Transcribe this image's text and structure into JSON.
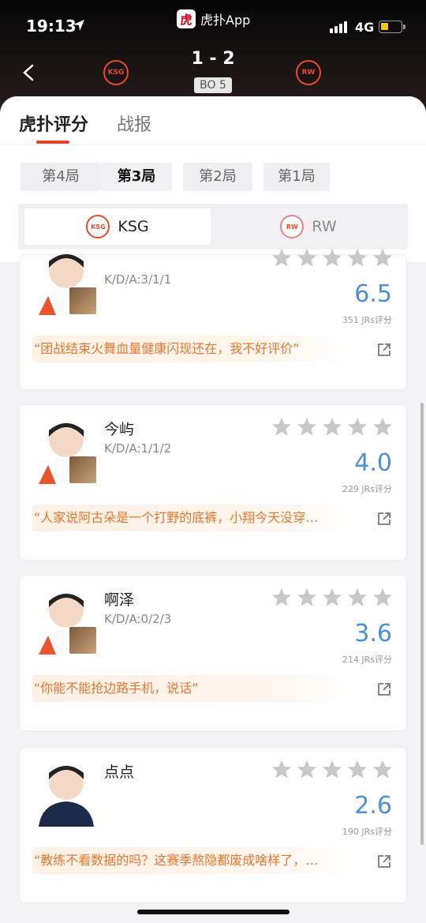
{
  "status_bar": {
    "time": "19:13",
    "network": "4G"
  },
  "app": {
    "name": "虎扑App",
    "logo_char": "虎"
  },
  "match": {
    "score": "1 - 2",
    "format": "BO 5",
    "team_a": "KSG",
    "team_b": "RW"
  },
  "tabs": [
    {
      "label": "虎扑评分"
    },
    {
      "label": "战报"
    }
  ],
  "rounds": [
    {
      "label": "第4局"
    },
    {
      "label": "第3局"
    },
    {
      "label": "第2局"
    },
    {
      "label": "第1局"
    }
  ],
  "selected_round": "第3局",
  "team_switch": [
    {
      "label": "KSG"
    },
    {
      "label": "RW"
    }
  ],
  "players": [
    {
      "name": "",
      "kda": "K/D/A:3/1/1",
      "rating": "6.5",
      "votes": "351 JRs评分",
      "quote": "“团战结束火舞血量健康闪现还在，我不好评价”",
      "stars_filled": 0
    },
    {
      "name": "今屿",
      "kda": "K/D/A:1/1/2",
      "rating": "4.0",
      "votes": "229 JRs评分",
      "quote": "“人家说阿古朵是一个打野的底裤，小翔今天没穿…",
      "stars_filled": 0
    },
    {
      "name": "啊泽",
      "kda": "K/D/A:0/2/3",
      "rating": "3.6",
      "votes": "214 JRs评分",
      "quote": "“你能不能抢边路手机，说话”",
      "stars_filled": 0
    },
    {
      "name": "点点",
      "kda": "",
      "rating": "2.6",
      "votes": "190 JRs评分",
      "quote": "“教练不看数据的吗？这赛季熬隐都废成啥样了，…",
      "stars_filled": 0
    }
  ],
  "colors": {
    "accent": "#e2402f",
    "rating": "#4a90d9",
    "quote": "#e8772e"
  }
}
